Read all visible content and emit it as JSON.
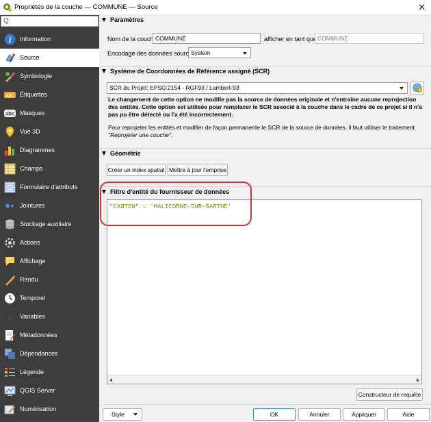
{
  "window": {
    "title": "Propriétés de la couche — COMMUNE — Source",
    "close_glyph": "✕"
  },
  "sidebar": {
    "search": {
      "value": "",
      "glyph": "Q"
    },
    "items": [
      {
        "label": "Information",
        "icon": "information-icon"
      },
      {
        "label": "Source",
        "icon": "source-icon"
      },
      {
        "label": "Symbologie",
        "icon": "symbology-icon"
      },
      {
        "label": "Étiquettes",
        "icon": "labels-icon"
      },
      {
        "label": "Masques",
        "icon": "masks-icon"
      },
      {
        "label": "Vue 3D",
        "icon": "3d-view-icon"
      },
      {
        "label": "Diagrammes",
        "icon": "diagrams-icon"
      },
      {
        "label": "Champs",
        "icon": "fields-icon"
      },
      {
        "label": "Formulaire d'attributs",
        "icon": "attribute-form-icon"
      },
      {
        "label": "Jointures",
        "icon": "joins-icon"
      },
      {
        "label": "Stockage auxiliaire",
        "icon": "auxiliary-storage-icon"
      },
      {
        "label": "Actions",
        "icon": "actions-icon"
      },
      {
        "label": "Affichage",
        "icon": "display-icon"
      },
      {
        "label": "Rendu",
        "icon": "rendering-icon"
      },
      {
        "label": "Temporel",
        "icon": "temporal-icon"
      },
      {
        "label": "Variables",
        "icon": "variables-icon"
      },
      {
        "label": "Métadonnées",
        "icon": "metadata-icon"
      },
      {
        "label": "Dépendances",
        "icon": "dependencies-icon"
      },
      {
        "label": "Légende",
        "icon": "legend-icon"
      },
      {
        "label": "QGIS Server",
        "icon": "qgis-server-icon"
      },
      {
        "label": "Numérisation",
        "icon": "digitizing-icon"
      }
    ],
    "active_index": 1
  },
  "params": {
    "header": "Paramètres",
    "layer_name_label": "Nom de la couche",
    "layer_name_value": "COMMUNE",
    "display_as_label": "afficher en tant que",
    "display_as_value": "COMMUNE",
    "encoding_label": "Encodage des données sources",
    "encoding_value": "System"
  },
  "crs": {
    "header": "Système de Coordonnées de Référence assigné (SCR)",
    "value": "SCR du Projet: EPSG:2154 - RGF93 / Lambert-93",
    "warning": "Le changement de cette option ne modifie pas la source de données originale et n'entraîne aucune reprojection des entités. Cette option est utilisée pour remplacer le SCR associé à la couche dans le cadre de ce projet si il n'a pas pu être détecté ou l'a été incorrectement.",
    "info_text": "Pour reprojeter les entités et modifier de façon permanente le SCR de la source de données, il faut utiliser le traitement",
    "info_link": "\"Reprojeter une couche\"",
    "info_end": "."
  },
  "geometry": {
    "header": "Géométrie",
    "spatial_index_button": "Créer un index spatial",
    "update_extent_button": "Mettre à jour l'emprise"
  },
  "filter": {
    "header": "Filtre d'entité du fournisseur de données",
    "expression": "\"CANTON\" = 'MALICORNE-SUR-SARTHE'",
    "query_builder_button": "Constructeur de requête"
  },
  "footer": {
    "style_button": "Style",
    "ok_button": "OK",
    "cancel_button": "Annuler",
    "apply_button": "Appliquer",
    "help_button": "Aide"
  },
  "colors": {
    "sidebar_bg": "#3c3c3c",
    "highlight": "#e02b2b",
    "expression_text": "#7a8a08",
    "qgis_green": "#589632"
  }
}
